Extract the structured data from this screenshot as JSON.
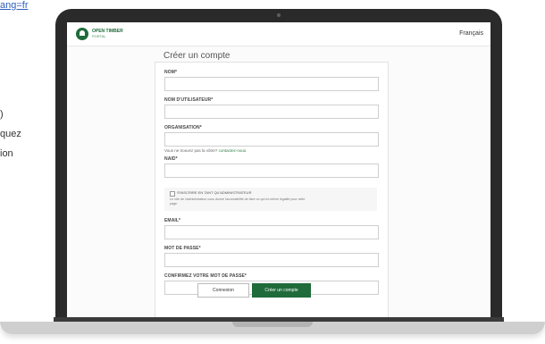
{
  "background": {
    "link": "ang=fr",
    "lines": [
      ")",
      "quez",
      "ion"
    ]
  },
  "header": {
    "logo_name": "OPEN TIMBER",
    "logo_sub": "PORTAL",
    "language": "Français"
  },
  "form": {
    "title": "Créer un compte",
    "fields": {
      "nom": "NOM*",
      "username": "NOM D'UTILISATEUR*",
      "organisation": "ORGANISATION*",
      "naid": "NAID*",
      "email": "EMAIL*",
      "password": "MOT DE PASSE*",
      "confirm": "CONFIRMEZ VOTRE MOT DE PASSE*"
    },
    "org_helper_text": "Vous ne trouvez pas la vôtre?",
    "org_helper_link": "contactez-nous.",
    "checkbox_label": "S'INSCRIRE EN TANT QU'ADMINISTRATEUR",
    "checkbox_desc": "Le rôle de l'administrateur vous donne l'accessibilité de faire ce qui lui-même légalité pour cette page.",
    "login_button": "Connexion",
    "create_button": "Créer un compte"
  },
  "colors": {
    "brand_green": "#1f6b3a",
    "laptop_bezel": "#2a2a2a"
  }
}
